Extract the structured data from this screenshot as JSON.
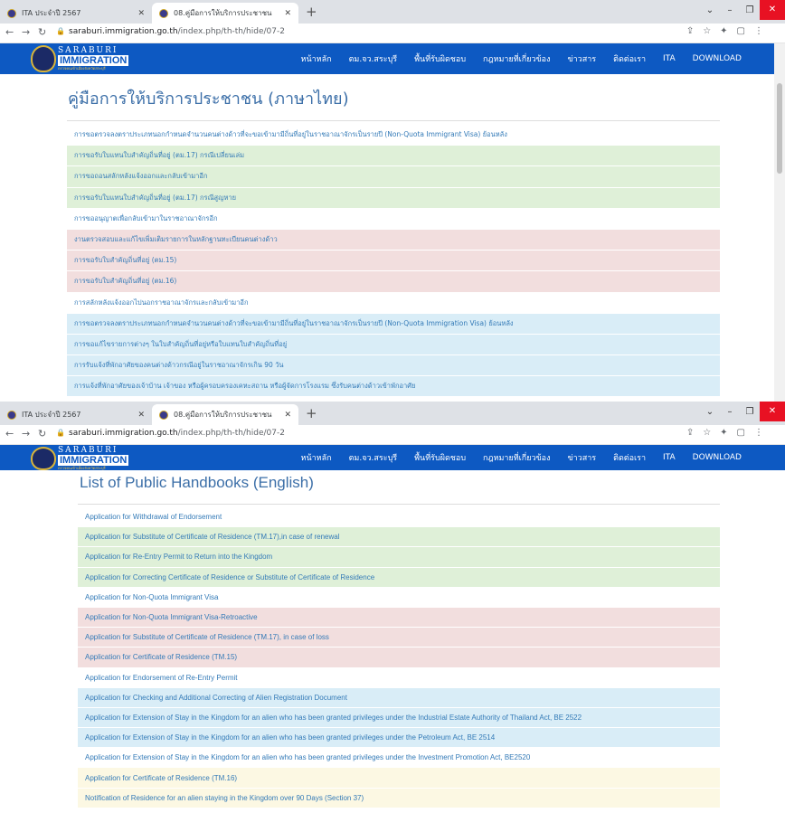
{
  "browser": {
    "tab1_title": "ITA ประจำปี 2567",
    "tab2_title": "08.คู่มือการให้บริการประชาชน",
    "url_host": "saraburi.immigration.go.th",
    "url_path": "/index.php/th-th/hide/07-2"
  },
  "site": {
    "logo_line1": "SARABURI",
    "logo_line2": "IMMIGRATION",
    "logo_line3": "ตรวจคนเข้าเมืองจังหวัดสระบุรี",
    "menu": [
      "หน้าหลัก",
      "ตม.จว.สระบุรี",
      "พื้นที่รับผิดชอบ",
      "กฎหมายที่เกี่ยวข้อง",
      "ข่าวสาร",
      "ติดต่อเรา",
      "ITA",
      "DOWNLOAD"
    ]
  },
  "thai_page": {
    "title": "คู่มือการให้บริการประชาชน (ภาษาไทย)",
    "items": [
      {
        "text": "การขอตรวจลงตราประเภทนอกกำหนดจำนวนคนต่างด้าวที่จะขอเข้ามามีถิ่นที่อยู่ในราชอาณาจักรเป็นรายปี (Non-Quota Immigrant Visa) ย้อนหลัง",
        "color": "white"
      },
      {
        "text": "การขอรับใบแทนใบสำคัญถิ่นที่อยู่ (ตม.17) กรณีเปลี่ยนเล่ม",
        "color": "green"
      },
      {
        "text": "การขอถอนสลักหลังแจ้งออกและกลับเข้ามาอีก",
        "color": "green"
      },
      {
        "text": "การขอรับใบแทนใบสำคัญถิ่นที่อยู่ (ตม.17) กรณีสูญหาย",
        "color": "green"
      },
      {
        "text": "การขออนุญาตเพื่อกลับเข้ามาในราชอาณาจักรอีก",
        "color": "white"
      },
      {
        "text": "งานตรวจสอบและแก้ไขเพิ่มเติมรายการในหลักฐานทะเบียนคนต่างด้าว",
        "color": "red"
      },
      {
        "text": "การขอรับใบสำคัญถิ่นที่อยู่ (ตม.15)",
        "color": "red"
      },
      {
        "text": "การขอรับใบสำคัญถิ่นที่อยู่ (ตม.16)",
        "color": "red"
      },
      {
        "text": "การสลักหลังแจ้งออกไปนอกราชอาณาจักรและกลับเข้ามาอีก",
        "color": "white"
      },
      {
        "text": "การขอตรวจลงตราประเภทนอกกำหนดจำนวนคนต่างด้าวที่จะขอเข้ามามีถิ่นที่อยู่ในราชอาณาจักรเป็นรายปี (Non-Quota Immigration Visa) ย้อนหลัง",
        "color": "blue"
      },
      {
        "text": "การขอแก้ไขรายการต่างๆ ในใบสำคัญถิ่นที่อยู่หรือใบแทนใบสำคัญถิ่นที่อยู่",
        "color": "blue"
      },
      {
        "text": "การรับแจ้งที่พักอาศัยของคนต่างด้าวกรณีอยู่ในราชอาณาจักรเกิน 90 วัน",
        "color": "blue"
      },
      {
        "text": "การแจ้งที่พักอาศัยของเจ้าบ้าน เจ้าของ หรือผู้ครอบครองเคหะสถาน หรือผู้จัดการโรงแรม ซึ่งรับคนต่างด้าวเข้าพักอาศัย",
        "color": "blue"
      }
    ]
  },
  "english_page": {
    "title": "List of Public Handbooks (English)",
    "items": [
      {
        "text": "Application for Withdrawal of Endorsement",
        "color": "white"
      },
      {
        "text": "Application for Substitute of Certificate of Residence (TM.17),in case of renewal",
        "color": "green"
      },
      {
        "text": "Application for Re-Entry Permit to Return into the Kingdom",
        "color": "green"
      },
      {
        "text": "Application for Correcting Certificate of Residence or Substitute of Certificate of Residence",
        "color": "green"
      },
      {
        "text": "Application for Non-Quota Immigrant Visa",
        "color": "white"
      },
      {
        "text": "Application for Non-Quota Immigrant Visa-Retroactive",
        "color": "red"
      },
      {
        "text": "Application for Substitute of Certificate of Residence (TM.17), in case of loss",
        "color": "red"
      },
      {
        "text": "Application for Certificate of Residence (TM.15)",
        "color": "red"
      },
      {
        "text": "Application for Endorsement of Re-Entry Permit",
        "color": "white"
      },
      {
        "text": "Application for Checking and Additional Correcting of Alien Registration Document",
        "color": "blue"
      },
      {
        "text": "Application for Extension of Stay in the Kingdom for an alien who has been granted privileges under the Industrial Estate Authority of Thailand Act, BE 2522",
        "color": "blue"
      },
      {
        "text": "Application for Extension of Stay in the Kingdom for an alien who has been granted privileges under the Petroleum Act, BE 2514",
        "color": "blue"
      },
      {
        "text": "Application for Extension of Stay in the Kingdom for an alien who has been granted privileges under the Investment Promotion Act, BE2520",
        "color": "white"
      },
      {
        "text": "Application for Certificate of Residence (TM.16)",
        "color": "yellow"
      },
      {
        "text": "Notification of Residence for an alien staying in the Kingdom over 90 Days (Section 37)",
        "color": "yellow"
      }
    ]
  }
}
